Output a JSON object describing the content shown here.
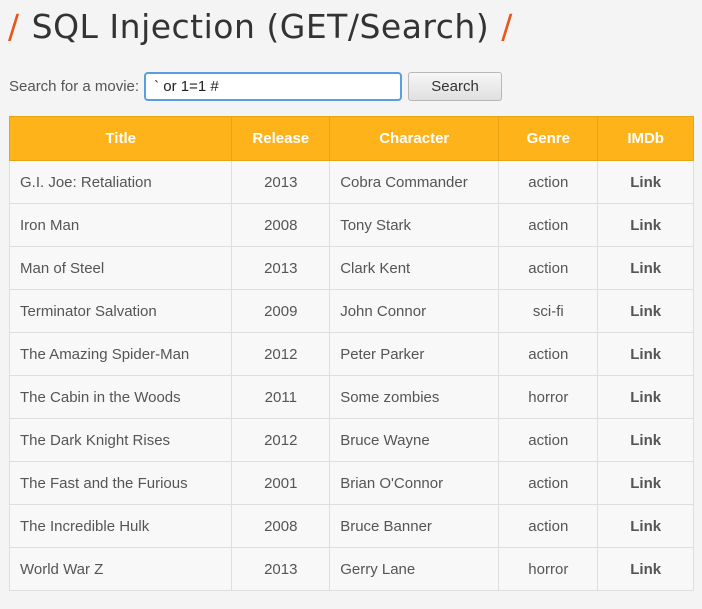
{
  "header": {
    "slash_left": "/",
    "title": "SQL Injection (GET/Search)",
    "slash_right": "/",
    "accent_color": "#e8561e"
  },
  "search": {
    "label": "Search for a movie:",
    "value": "` or 1=1 #",
    "button_label": "Search"
  },
  "table": {
    "header_color": "#ffb31a",
    "columns": [
      "Title",
      "Release",
      "Character",
      "Genre",
      "IMDb"
    ],
    "rows": [
      {
        "title": "G.I. Joe: Retaliation",
        "release": "2013",
        "character": "Cobra Commander",
        "genre": "action",
        "imdb": "Link"
      },
      {
        "title": "Iron Man",
        "release": "2008",
        "character": "Tony Stark",
        "genre": "action",
        "imdb": "Link"
      },
      {
        "title": "Man of Steel",
        "release": "2013",
        "character": "Clark Kent",
        "genre": "action",
        "imdb": "Link"
      },
      {
        "title": "Terminator Salvation",
        "release": "2009",
        "character": "John Connor",
        "genre": "sci-fi",
        "imdb": "Link"
      },
      {
        "title": "The Amazing Spider-Man",
        "release": "2012",
        "character": "Peter Parker",
        "genre": "action",
        "imdb": "Link"
      },
      {
        "title": "The Cabin in the Woods",
        "release": "2011",
        "character": "Some zombies",
        "genre": "horror",
        "imdb": "Link"
      },
      {
        "title": "The Dark Knight Rises",
        "release": "2012",
        "character": "Bruce Wayne",
        "genre": "action",
        "imdb": "Link"
      },
      {
        "title": "The Fast and the Furious",
        "release": "2001",
        "character": "Brian O'Connor",
        "genre": "action",
        "imdb": "Link"
      },
      {
        "title": "The Incredible Hulk",
        "release": "2008",
        "character": "Bruce Banner",
        "genre": "action",
        "imdb": "Link"
      },
      {
        "title": "World War Z",
        "release": "2013",
        "character": "Gerry Lane",
        "genre": "horror",
        "imdb": "Link"
      }
    ]
  }
}
